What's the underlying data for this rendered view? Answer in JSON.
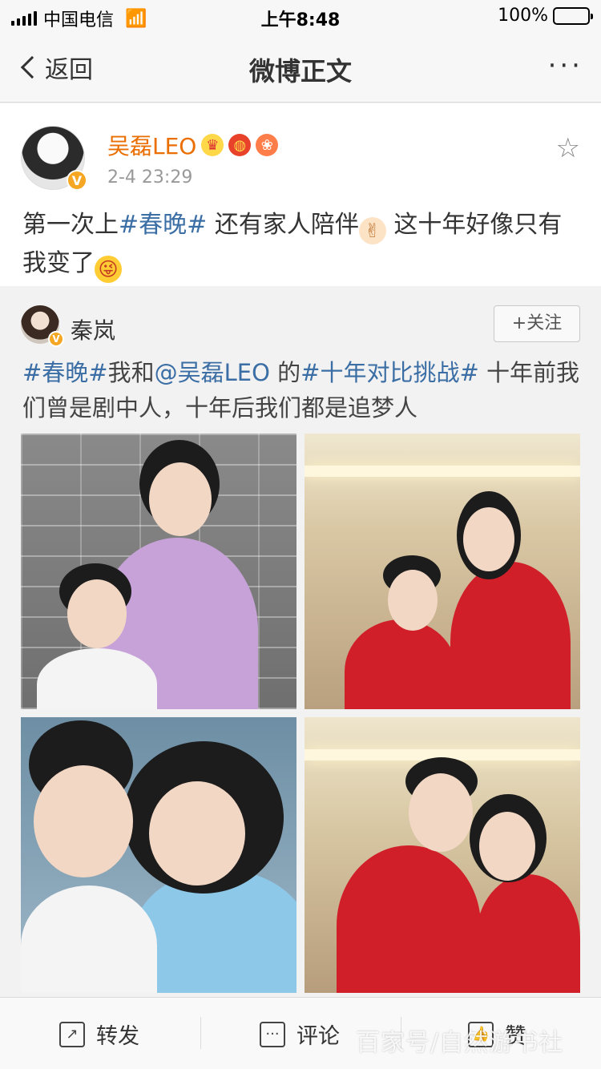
{
  "status_bar": {
    "carrier": "中国电信",
    "time": "上午8:48",
    "battery": "100%",
    "battery_level": 1.0
  },
  "nav": {
    "back_label": "返回",
    "title": "微博正文",
    "more_label": "···"
  },
  "post": {
    "author": "吴磊LEO",
    "verified_badge": "V",
    "badges": [
      "crown-badge",
      "lantern-badge",
      "fire-badge"
    ],
    "time": "2-4 23:29",
    "text_parts": {
      "p1": "第一次上",
      "tag": "#春晚#",
      "p2": " 还有家人陪伴",
      "emoji1": "✌",
      "p3": " 这十年好像只有我变了",
      "emoji2": "😜"
    },
    "favorite_icon": "star-icon"
  },
  "repost": {
    "author": "秦岚",
    "verified_badge": "V",
    "follow_label": "+关注",
    "text_parts": {
      "tag1": "#春晚#",
      "p1": "我和",
      "mention": "@吴磊LEO",
      "p2": " 的",
      "tag2": "#十年对比挑战#",
      "p3": " 十年前我们曾是剧中人，十年后我们都是追梦人"
    },
    "photos": [
      "photo-1",
      "photo-2",
      "photo-3",
      "photo-4"
    ]
  },
  "bottom_bar": {
    "repost_label": "转发",
    "comment_label": "评论",
    "like_label": "赞"
  },
  "watermark": "百家号/自然游书社",
  "colors": {
    "author": "#ea6e00",
    "tag": "#3b6ea5",
    "verified": "#f5a623"
  }
}
